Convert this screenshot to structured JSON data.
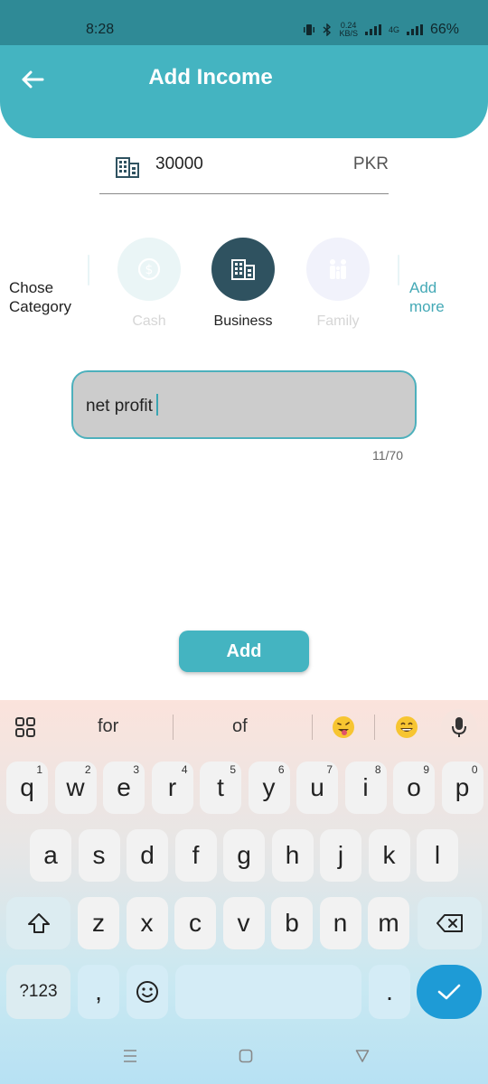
{
  "status": {
    "time": "8:28",
    "speed_value": "0.24",
    "speed_unit": "KB/S",
    "network": "4G",
    "battery": "66%"
  },
  "header": {
    "title": "Add Income"
  },
  "amount": {
    "value": "30000",
    "currency": "PKR",
    "icon": "building-icon"
  },
  "category": {
    "label": "Chose\nCategory",
    "add_more": "Add\nmore",
    "items": [
      {
        "name": "Cash",
        "icon": "dollar-coin-icon",
        "selected": false
      },
      {
        "name": "Business",
        "icon": "building-icon",
        "selected": true
      },
      {
        "name": "Family",
        "icon": "family-icon",
        "selected": false
      }
    ]
  },
  "note": {
    "value": "net profit",
    "counter": "11/70"
  },
  "actions": {
    "add_label": "Add"
  },
  "keyboard": {
    "suggestions": [
      "for",
      "of"
    ],
    "row1": [
      {
        "k": "q",
        "h": "1"
      },
      {
        "k": "w",
        "h": "2"
      },
      {
        "k": "e",
        "h": "3"
      },
      {
        "k": "r",
        "h": "4"
      },
      {
        "k": "t",
        "h": "5"
      },
      {
        "k": "y",
        "h": "6"
      },
      {
        "k": "u",
        "h": "7"
      },
      {
        "k": "i",
        "h": "8"
      },
      {
        "k": "o",
        "h": "9"
      },
      {
        "k": "p",
        "h": "0"
      }
    ],
    "row2": [
      "a",
      "s",
      "d",
      "f",
      "g",
      "h",
      "j",
      "k",
      "l"
    ],
    "row3": [
      "z",
      "x",
      "c",
      "v",
      "b",
      "n",
      "m"
    ],
    "symbols_label": "?123",
    "comma": ",",
    "period": "."
  },
  "colors": {
    "primary": "#44b4c1",
    "selected": "#2f5260",
    "enter": "#1e9bd6"
  }
}
